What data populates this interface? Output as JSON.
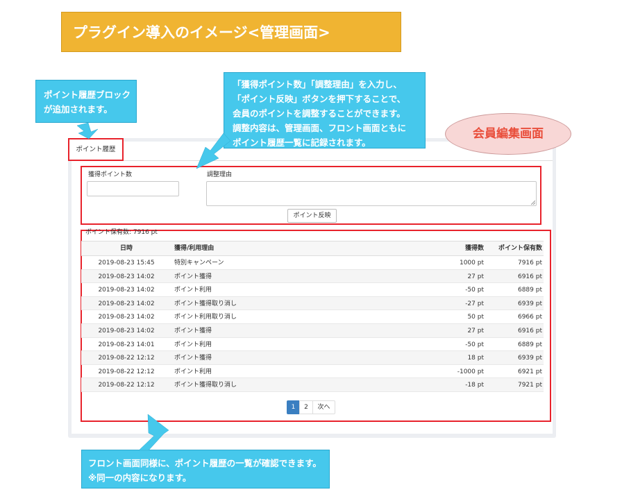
{
  "title": "プラグイン導入のイメージ<管理画面>",
  "callouts": {
    "block_added": [
      "ポイント履歴ブロック",
      "が追加されます。"
    ],
    "adjust": [
      "「獲得ポイント数」「調整理由」を入力し、",
      "「ポイント反映」ボタンを押下することで、",
      "会員のポイントを調整することができます。",
      "調整内容は、管理画面、フロント画面ともに",
      "ポイント履歴一覧に記録されます。"
    ],
    "front": [
      "フロント画面同様に、ポイント履歴の一覧が確認できます。",
      "※同一の内容になります。"
    ]
  },
  "ellipse_label": "会員編集画面",
  "tab_label": "ポイント履歴",
  "form": {
    "points_label": "獲得ポイント数",
    "reason_label": "調整理由",
    "points_value": "",
    "reason_value": "",
    "submit_label": "ポイント反映"
  },
  "balance_text": "ポイント保有数: 7916 pt",
  "table": {
    "headers": [
      "日時",
      "獲得/利用理由",
      "獲得数",
      "ポイント保有数"
    ],
    "rows": [
      [
        "2019-08-23 15:45",
        "特別キャンペーン",
        "1000 pt",
        "7916 pt"
      ],
      [
        "2019-08-23 14:02",
        "ポイント獲得",
        "27 pt",
        "6916 pt"
      ],
      [
        "2019-08-23 14:02",
        "ポイント利用",
        "-50 pt",
        "6889 pt"
      ],
      [
        "2019-08-23 14:02",
        "ポイント獲得取り消し",
        "-27 pt",
        "6939 pt"
      ],
      [
        "2019-08-23 14:02",
        "ポイント利用取り消し",
        "50 pt",
        "6966 pt"
      ],
      [
        "2019-08-23 14:02",
        "ポイント獲得",
        "27 pt",
        "6916 pt"
      ],
      [
        "2019-08-23 14:01",
        "ポイント利用",
        "-50 pt",
        "6889 pt"
      ],
      [
        "2019-08-22 12:12",
        "ポイント獲得",
        "18 pt",
        "6939 pt"
      ],
      [
        "2019-08-22 12:12",
        "ポイント利用",
        "-1000 pt",
        "6921 pt"
      ],
      [
        "2019-08-22 12:12",
        "ポイント獲得取り消し",
        "-18 pt",
        "7921 pt"
      ]
    ]
  },
  "pagination": {
    "current": "1",
    "page2": "2",
    "next": "次へ"
  },
  "colors": {
    "banner": "#F0B432",
    "callout": "#46C8EC",
    "highlight": "#E8222B",
    "ellipse_text": "#E94E3B",
    "pager_active": "#3A7FC1"
  }
}
